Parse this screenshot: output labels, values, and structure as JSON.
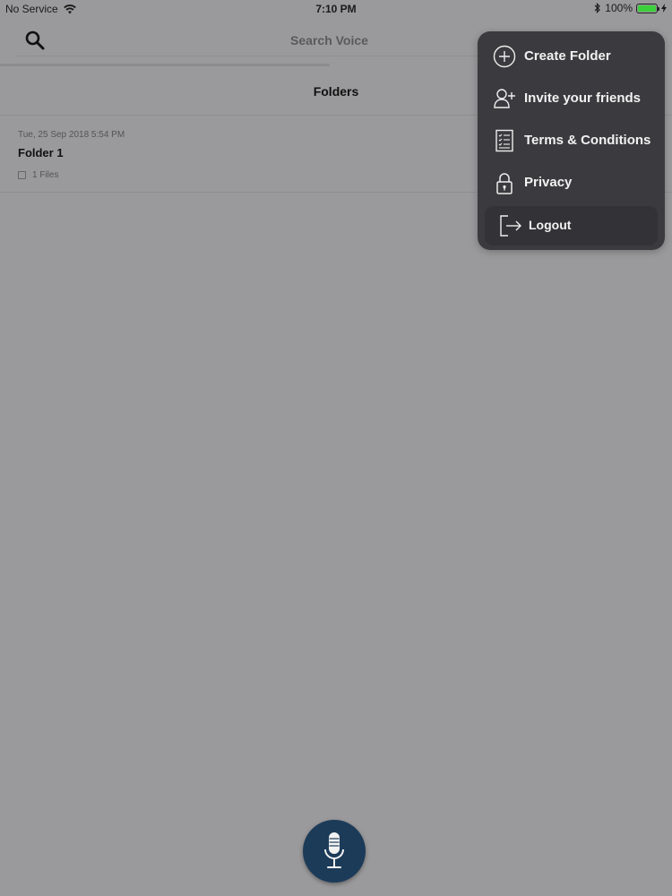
{
  "status_bar": {
    "carrier": "No Service",
    "time": "7:10 PM",
    "battery_percent": "100%",
    "battery_level": 1.0,
    "wifi_icon": "wifi-icon",
    "bluetooth_icon": "bluetooth-icon"
  },
  "search": {
    "placeholder": "Search Voice",
    "value": "",
    "progress": 0.49
  },
  "page": {
    "title": "Folders"
  },
  "folders": [
    {
      "date": "Tue, 25 Sep 2018 5:54 PM",
      "name": "Folder 1",
      "files": "1 Files"
    }
  ],
  "menu": {
    "items": [
      {
        "label": "Create Folder",
        "icon": "plus-circle-icon"
      },
      {
        "label": "Invite your friends",
        "icon": "add-user-icon"
      },
      {
        "label": "Terms & Conditions",
        "icon": "document-icon"
      },
      {
        "label": "Privacy",
        "icon": "lock-icon"
      },
      {
        "label": "Logout",
        "icon": "logout-icon"
      }
    ]
  },
  "colors": {
    "background": "#9a999b",
    "menu_bg": "#3b3a3e",
    "mic_button": "#1c3b59",
    "battery": "#3ccf3c"
  },
  "mic_icon": "microphone-icon"
}
